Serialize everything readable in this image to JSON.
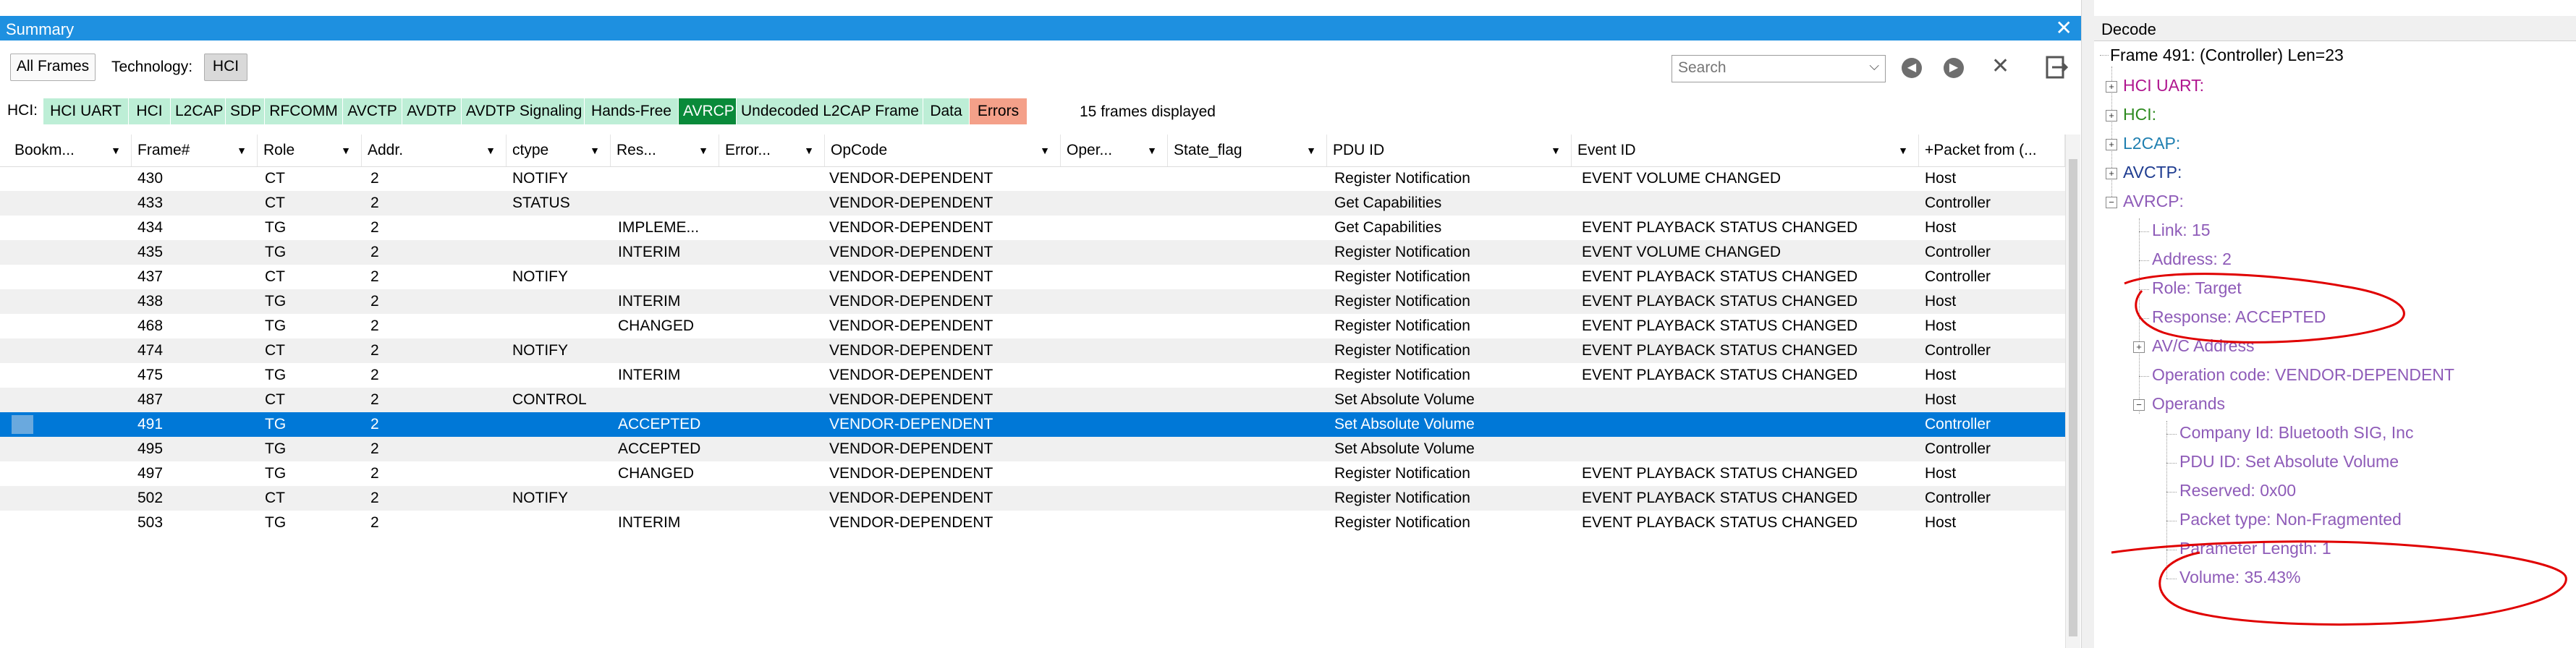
{
  "colors": {
    "title_bar": "#1e90e0",
    "selected_row": "#0078d7",
    "annotation": "#e00000",
    "decode_text": "#8e5bb8"
  },
  "summary": {
    "title": "Summary",
    "close_icon": "close-icon",
    "toolbar": {
      "all_frames_label": "All Frames",
      "technology_label": "Technology:",
      "technology_value": "HCI",
      "search_placeholder": "Search"
    },
    "filter": {
      "label": "HCI:",
      "items": [
        {
          "label": "HCI UART",
          "color": "#bdeed6"
        },
        {
          "label": "HCI",
          "color": "#bdeed6"
        },
        {
          "label": "L2CAP",
          "color": "#bdeed6"
        },
        {
          "label": "SDP",
          "color": "#bdeed6"
        },
        {
          "label": "RFCOMM",
          "color": "#bdeed6"
        },
        {
          "label": "AVCTP",
          "color": "#bdeed6"
        },
        {
          "label": "AVDTP",
          "color": "#bdeed6"
        },
        {
          "label": "AVDTP Signaling",
          "color": "#bdeed6"
        },
        {
          "label": "Hands-Free",
          "color": "#bdeed6"
        },
        {
          "label": "AVRCP",
          "color": "#0a8a3a"
        },
        {
          "label": "Undecoded L2CAP Frame",
          "color": "#bdeed6"
        },
        {
          "label": "Data",
          "color": "#bdeed6"
        },
        {
          "label": "Errors",
          "color": "#f4a089"
        }
      ],
      "frames_displayed": "15 frames displayed"
    },
    "columns": [
      "Bookm...",
      "Frame#",
      "Role",
      "Addr.",
      "ctype",
      "Res...",
      "Error...",
      "OpCode",
      "Oper...",
      "State_flag",
      "PDU ID",
      "Event ID",
      "+Packet from (..."
    ],
    "rows": [
      {
        "frame": "430",
        "role": "CT",
        "addr": "2",
        "ctype": "NOTIFY",
        "res": "",
        "opcode": "VENDOR-DEPENDENT",
        "pdu": "Register Notification",
        "event": "EVENT VOLUME CHANGED",
        "from": "Host"
      },
      {
        "frame": "433",
        "role": "CT",
        "addr": "2",
        "ctype": "STATUS",
        "res": "",
        "opcode": "VENDOR-DEPENDENT",
        "pdu": "Get Capabilities",
        "event": "",
        "from": "Controller"
      },
      {
        "frame": "434",
        "role": "TG",
        "addr": "2",
        "ctype": "",
        "res": "IMPLEME...",
        "opcode": "VENDOR-DEPENDENT",
        "pdu": "Get Capabilities",
        "event": "EVENT PLAYBACK STATUS CHANGED",
        "from": "Host"
      },
      {
        "frame": "435",
        "role": "TG",
        "addr": "2",
        "ctype": "",
        "res": "INTERIM",
        "opcode": "VENDOR-DEPENDENT",
        "pdu": "Register Notification",
        "event": "EVENT VOLUME CHANGED",
        "from": "Controller"
      },
      {
        "frame": "437",
        "role": "CT",
        "addr": "2",
        "ctype": "NOTIFY",
        "res": "",
        "opcode": "VENDOR-DEPENDENT",
        "pdu": "Register Notification",
        "event": "EVENT PLAYBACK STATUS CHANGED",
        "from": "Controller"
      },
      {
        "frame": "438",
        "role": "TG",
        "addr": "2",
        "ctype": "",
        "res": "INTERIM",
        "opcode": "VENDOR-DEPENDENT",
        "pdu": "Register Notification",
        "event": "EVENT PLAYBACK STATUS CHANGED",
        "from": "Host"
      },
      {
        "frame": "468",
        "role": "TG",
        "addr": "2",
        "ctype": "",
        "res": "CHANGED",
        "opcode": "VENDOR-DEPENDENT",
        "pdu": "Register Notification",
        "event": "EVENT PLAYBACK STATUS CHANGED",
        "from": "Host"
      },
      {
        "frame": "474",
        "role": "CT",
        "addr": "2",
        "ctype": "NOTIFY",
        "res": "",
        "opcode": "VENDOR-DEPENDENT",
        "pdu": "Register Notification",
        "event": "EVENT PLAYBACK STATUS CHANGED",
        "from": "Controller"
      },
      {
        "frame": "475",
        "role": "TG",
        "addr": "2",
        "ctype": "",
        "res": "INTERIM",
        "opcode": "VENDOR-DEPENDENT",
        "pdu": "Register Notification",
        "event": "EVENT PLAYBACK STATUS CHANGED",
        "from": "Host"
      },
      {
        "frame": "487",
        "role": "CT",
        "addr": "2",
        "ctype": "CONTROL",
        "res": "",
        "opcode": "VENDOR-DEPENDENT",
        "pdu": "Set Absolute Volume",
        "event": "",
        "from": "Host"
      },
      {
        "frame": "491",
        "role": "TG",
        "addr": "2",
        "ctype": "",
        "res": "ACCEPTED",
        "opcode": "VENDOR-DEPENDENT",
        "pdu": "Set Absolute Volume",
        "event": "",
        "from": "Controller",
        "selected": true
      },
      {
        "frame": "495",
        "role": "TG",
        "addr": "2",
        "ctype": "",
        "res": "ACCEPTED",
        "opcode": "VENDOR-DEPENDENT",
        "pdu": "Set Absolute Volume",
        "event": "",
        "from": "Controller"
      },
      {
        "frame": "497",
        "role": "TG",
        "addr": "2",
        "ctype": "",
        "res": "CHANGED",
        "opcode": "VENDOR-DEPENDENT",
        "pdu": "Register Notification",
        "event": "EVENT PLAYBACK STATUS CHANGED",
        "from": "Host"
      },
      {
        "frame": "502",
        "role": "CT",
        "addr": "2",
        "ctype": "NOTIFY",
        "res": "",
        "opcode": "VENDOR-DEPENDENT",
        "pdu": "Register Notification",
        "event": "EVENT PLAYBACK STATUS CHANGED",
        "from": "Controller"
      },
      {
        "frame": "503",
        "role": "TG",
        "addr": "2",
        "ctype": "",
        "res": "INTERIM",
        "opcode": "VENDOR-DEPENDENT",
        "pdu": "Register Notification",
        "event": "EVENT PLAYBACK STATUS CHANGED",
        "from": "Host"
      }
    ]
  },
  "decode": {
    "title": "Decode",
    "frame_line": "Frame 491: (Controller) Len=23",
    "hci_uart": "HCI UART:",
    "hci": "HCI:",
    "l2cap": "L2CAP:",
    "avctp": "AVCTP:",
    "avrcp": "AVRCP:",
    "link": "Link: 15",
    "address": "Address: 2",
    "role": "Role: Target",
    "response": "Response: ACCEPTED",
    "avc_address": "AV/C Address",
    "operation_code": "Operation code: VENDOR-DEPENDENT",
    "operands": "Operands",
    "company_id": "Company Id: Bluetooth SIG, Inc",
    "pdu_id": "PDU ID: Set Absolute Volume",
    "reserved": "Reserved: 0x00",
    "packet_type": "Packet type: Non-Fragmented",
    "parameter_length": "Parameter Length: 1",
    "volume": "Volume: 35.43%"
  }
}
